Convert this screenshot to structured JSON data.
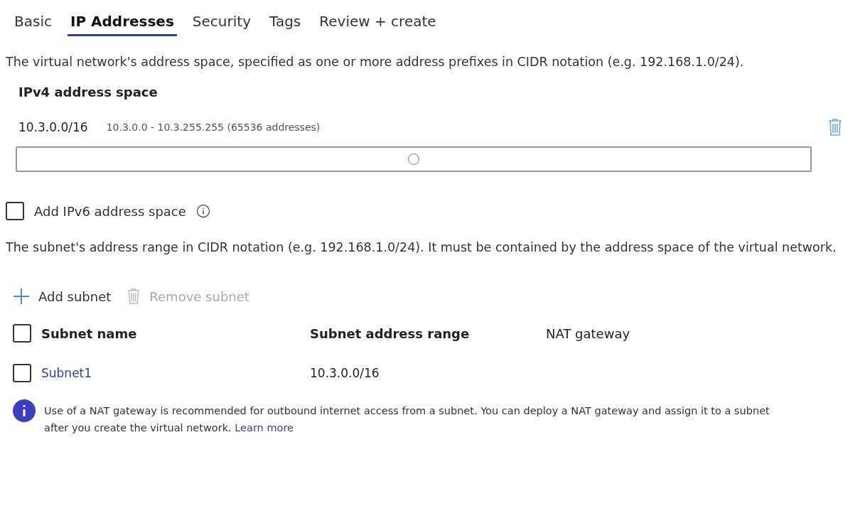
{
  "tabs": [
    {
      "label": "Basic",
      "selected": false
    },
    {
      "label": "IP Addresses",
      "selected": true
    },
    {
      "label": "Security",
      "selected": false
    },
    {
      "label": "Tags",
      "selected": false
    },
    {
      "label": "Review + create",
      "selected": false
    }
  ],
  "address_space_description": "The virtual network's address space, specified as one or more address prefixes in CIDR notation (e.g. 192.168.1.0/24).",
  "ipv4": {
    "heading": "IPv4 address space",
    "entries": [
      {
        "prefix": "10.3.0.0/16",
        "range": "10.3.0.0 - 10.3.255.255 (65536 addresses)"
      }
    ]
  },
  "ipv6_option": {
    "label": "Add IPv6 address space",
    "checked": false
  },
  "subnet_description": "The subnet's address range in CIDR notation (e.g. 192.168.1.0/24). It must be contained by the address space of the virtual network.",
  "toolbar": [
    {
      "kind": "add",
      "label": "Add subnet",
      "disabled": false
    },
    {
      "kind": "remove",
      "label": "Remove subnet",
      "disabled": true
    }
  ],
  "table": {
    "select_all_checked": false,
    "columns": [
      "Subnet name",
      "Subnet address range",
      "NAT gateway"
    ],
    "rows": [
      {
        "checked": false,
        "name": "Subnet1",
        "range": "10.3.0.0/16"
      }
    ]
  },
  "info": {
    "text": "Use of a NAT gateway is recommended for outbound internet access from a subnet. You can deploy a NAT gateway and assign it to a subnet after you create the virtual network.",
    "link": "Learn more"
  }
}
